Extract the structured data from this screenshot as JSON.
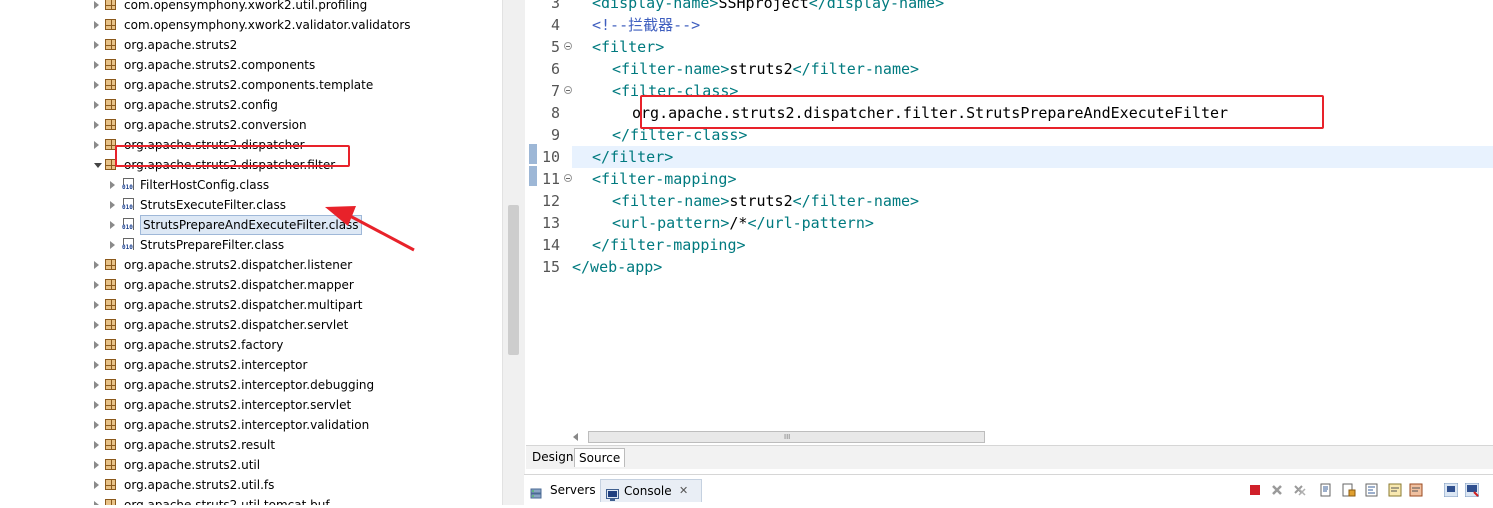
{
  "tree": {
    "items": [
      {
        "label": "com.opensymphony.xwork2.util.profiling",
        "kind": "package",
        "state": "closed"
      },
      {
        "label": "com.opensymphony.xwork2.validator.validators",
        "kind": "package",
        "state": "closed"
      },
      {
        "label": "org.apache.struts2",
        "kind": "package",
        "state": "closed"
      },
      {
        "label": "org.apache.struts2.components",
        "kind": "package",
        "state": "closed"
      },
      {
        "label": "org.apache.struts2.components.template",
        "kind": "package",
        "state": "closed"
      },
      {
        "label": "org.apache.struts2.config",
        "kind": "package",
        "state": "closed"
      },
      {
        "label": "org.apache.struts2.conversion",
        "kind": "package",
        "state": "closed"
      },
      {
        "label": "org.apache.struts2.dispatcher",
        "kind": "package",
        "state": "closed"
      },
      {
        "label": "org.apache.struts2.dispatcher.filter",
        "kind": "package",
        "state": "open"
      },
      {
        "label": "FilterHostConfig.class",
        "kind": "class",
        "state": "closed"
      },
      {
        "label": "StrutsExecuteFilter.class",
        "kind": "class",
        "state": "closed"
      },
      {
        "label": "StrutsPrepareAndExecuteFilter.class",
        "kind": "class",
        "state": "closed",
        "selected": true
      },
      {
        "label": "StrutsPrepareFilter.class",
        "kind": "class",
        "state": "closed"
      },
      {
        "label": "org.apache.struts2.dispatcher.listener",
        "kind": "package",
        "state": "closed"
      },
      {
        "label": "org.apache.struts2.dispatcher.mapper",
        "kind": "package",
        "state": "closed"
      },
      {
        "label": "org.apache.struts2.dispatcher.multipart",
        "kind": "package",
        "state": "closed"
      },
      {
        "label": "org.apache.struts2.dispatcher.servlet",
        "kind": "package",
        "state": "closed"
      },
      {
        "label": "org.apache.struts2.factory",
        "kind": "package",
        "state": "closed"
      },
      {
        "label": "org.apache.struts2.interceptor",
        "kind": "package",
        "state": "closed"
      },
      {
        "label": "org.apache.struts2.interceptor.debugging",
        "kind": "package",
        "state": "closed"
      },
      {
        "label": "org.apache.struts2.interceptor.servlet",
        "kind": "package",
        "state": "closed"
      },
      {
        "label": "org.apache.struts2.interceptor.validation",
        "kind": "package",
        "state": "closed"
      },
      {
        "label": "org.apache.struts2.result",
        "kind": "package",
        "state": "closed"
      },
      {
        "label": "org.apache.struts2.util",
        "kind": "package",
        "state": "closed"
      },
      {
        "label": "org.apache.struts2.util.fs",
        "kind": "package",
        "state": "closed"
      },
      {
        "label": "org.apache.struts2.util.tomcat.buf",
        "kind": "package",
        "state": "closed"
      }
    ]
  },
  "editor": {
    "lines": [
      {
        "num": "3",
        "fold": false,
        "parts": [
          [
            "tag",
            "<display-name>"
          ],
          [
            "txt",
            "SSHproject"
          ],
          [
            "tag",
            "</display-name>"
          ]
        ]
      },
      {
        "num": "4",
        "fold": false,
        "parts": [
          [
            "cmt",
            "<!--拦截器-->"
          ]
        ]
      },
      {
        "num": "5",
        "fold": true,
        "parts": [
          [
            "tag",
            "<filter>"
          ]
        ]
      },
      {
        "num": "6",
        "fold": false,
        "parts": [
          [
            "tag",
            "<filter-name>"
          ],
          [
            "txt",
            "struts2"
          ],
          [
            "tag",
            "</filter-name>"
          ]
        ]
      },
      {
        "num": "7",
        "fold": true,
        "parts": [
          [
            "tag",
            "<filter-class>"
          ]
        ]
      },
      {
        "num": "8",
        "fold": false,
        "parts": [
          [
            "txt",
            "org.apache.struts2.dispatcher.filter.StrutsPrepareAndExecuteFilter"
          ]
        ]
      },
      {
        "num": "9",
        "fold": false,
        "parts": [
          [
            "tag",
            "</filter-class>"
          ]
        ]
      },
      {
        "num": "10",
        "fold": false,
        "parts": [
          [
            "tag",
            "</filter>"
          ]
        ],
        "current": true
      },
      {
        "num": "11",
        "fold": true,
        "parts": [
          [
            "tag",
            "<filter-mapping>"
          ]
        ]
      },
      {
        "num": "12",
        "fold": false,
        "parts": [
          [
            "tag",
            "<filter-name>"
          ],
          [
            "txt",
            "struts2"
          ],
          [
            "tag",
            "</filter-name>"
          ]
        ]
      },
      {
        "num": "13",
        "fold": false,
        "parts": [
          [
            "tag",
            "<url-pattern>"
          ],
          [
            "txt",
            "/*"
          ],
          [
            "tag",
            "</url-pattern>"
          ]
        ]
      },
      {
        "num": "14",
        "fold": false,
        "parts": [
          [
            "tag",
            "</filter-mapping>"
          ]
        ]
      },
      {
        "num": "15",
        "fold": false,
        "parts": [
          [
            "tag",
            "</web-app>"
          ]
        ]
      }
    ],
    "tabs": [
      {
        "label": "Design"
      },
      {
        "label": "Source",
        "active": true
      }
    ],
    "scroll_grip": "III"
  },
  "views": {
    "tabs": [
      {
        "label": "Servers",
        "icon": "servers-icon"
      },
      {
        "label": "Console",
        "icon": "console-icon",
        "active": true,
        "close": "✕"
      }
    ],
    "toolbar": [
      "terminate-icon",
      "remove-launch-icon",
      "remove-all-terminated-icon",
      "clear-console-icon",
      "scroll-lock-icon",
      "word-wrap-icon",
      "show-console-on-output-icon",
      "show-console-on-error-icon",
      "pin-console-icon",
      "display-selected-console-icon"
    ]
  },
  "colors": {
    "annotation_red": "#e8222a",
    "xml_tag": "#007a7f",
    "xml_comment": "#3f5fbf",
    "current_line": "#e8f2fe"
  }
}
